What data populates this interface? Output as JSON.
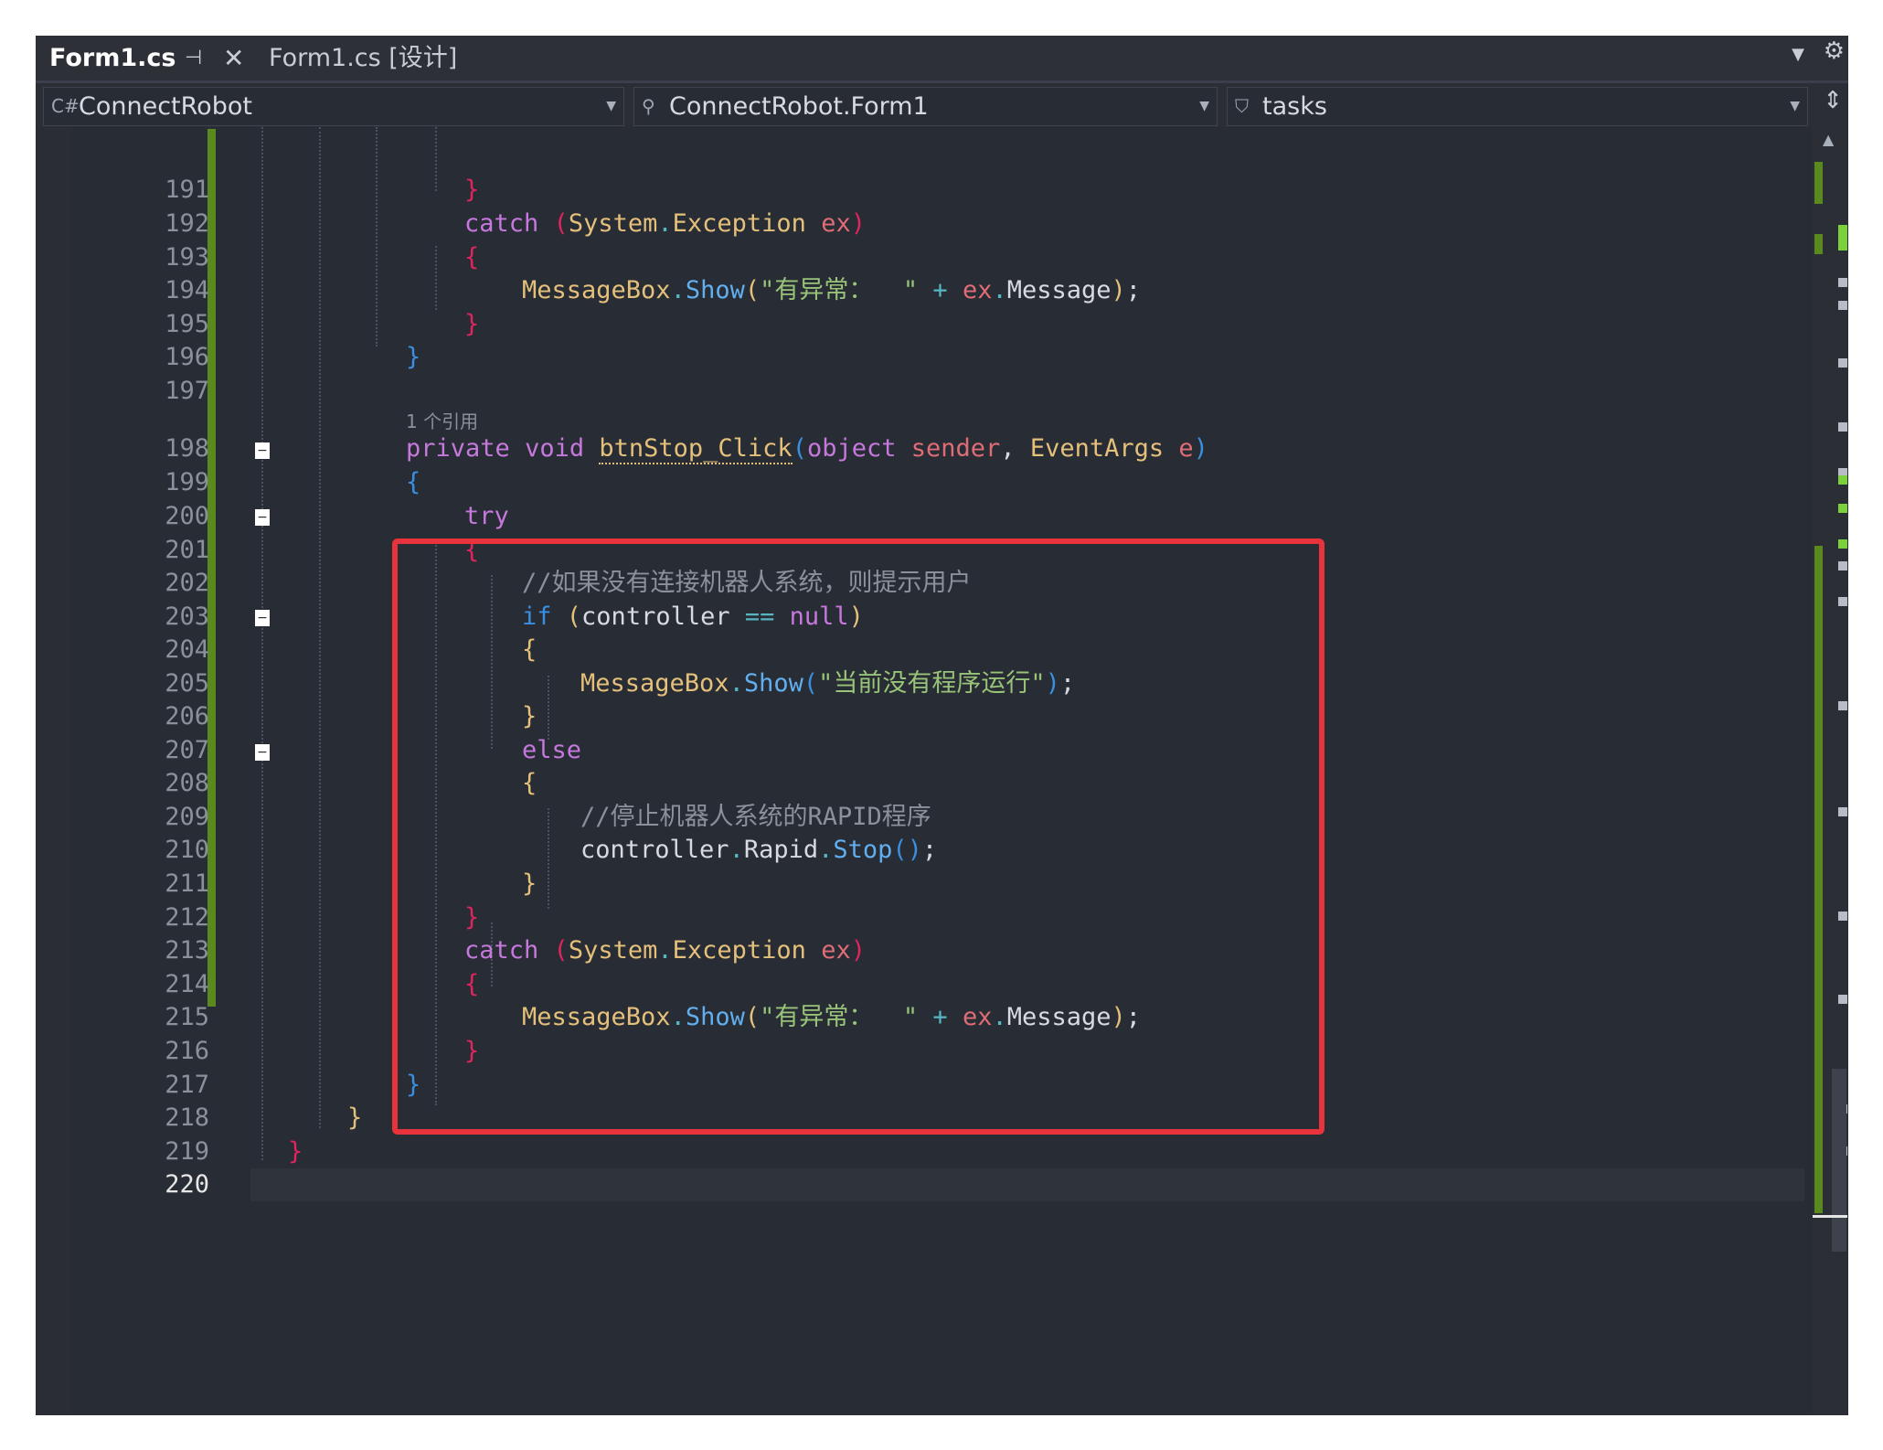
{
  "tabs": {
    "active": "Form1.cs",
    "pin_icon": "pin-icon",
    "close_icon": "close-icon",
    "design": "Form1.cs [设计]",
    "menu_icon": "dropdown-icon",
    "gear_icon": "gear-icon"
  },
  "navbar": {
    "project": "ConnectRobot",
    "class": "ConnectRobot.Form1",
    "member": "tasks"
  },
  "editor": {
    "reference_hint": "1 个引用",
    "lines": [
      {
        "n": "191"
      },
      {
        "n": "192"
      },
      {
        "n": "193"
      },
      {
        "n": "194"
      },
      {
        "n": "195"
      },
      {
        "n": "196"
      },
      {
        "n": "197"
      },
      {
        "n": "198"
      },
      {
        "n": "199"
      },
      {
        "n": "200"
      },
      {
        "n": "201"
      },
      {
        "n": "202"
      },
      {
        "n": "203"
      },
      {
        "n": "204"
      },
      {
        "n": "205"
      },
      {
        "n": "206"
      },
      {
        "n": "207"
      },
      {
        "n": "208"
      },
      {
        "n": "209"
      },
      {
        "n": "210"
      },
      {
        "n": "211"
      },
      {
        "n": "212"
      },
      {
        "n": "213"
      },
      {
        "n": "214"
      },
      {
        "n": "215"
      },
      {
        "n": "216"
      },
      {
        "n": "217"
      },
      {
        "n": "218"
      },
      {
        "n": "219"
      },
      {
        "n": "220"
      }
    ],
    "strings": {
      "err_msg": "\"有异常：  \"",
      "no_program": "\"当前没有程序运行\"",
      "comment_check": "//如果没有连接机器人系统，则提示用户",
      "comment_stop": "//停止机器人系统的RAPID程序"
    }
  },
  "colors": {
    "background": "#282c34",
    "highlight_box": "#e8333d",
    "change_bar": "#5a8a1e"
  }
}
